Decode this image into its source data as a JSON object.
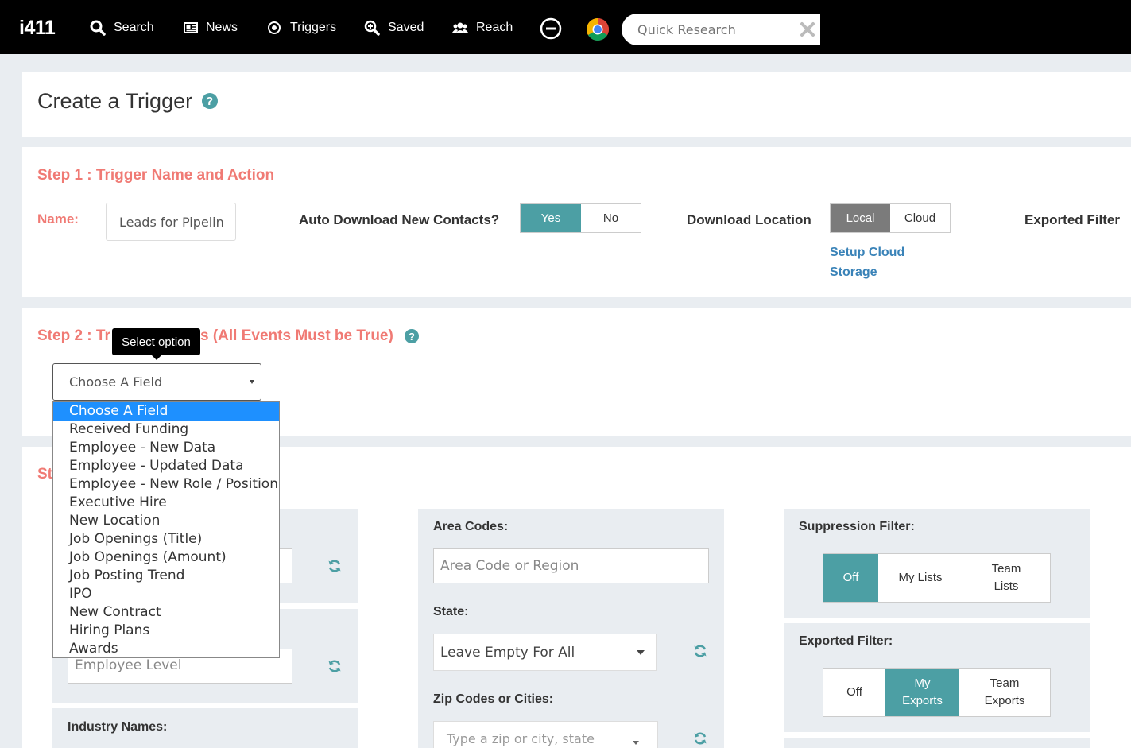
{
  "navbar": {
    "logo": "i411",
    "items": [
      {
        "label": "Search",
        "icon": "search-icon"
      },
      {
        "label": "News",
        "icon": "newspaper-icon"
      },
      {
        "label": "Triggers",
        "icon": "target-icon"
      },
      {
        "label": "Saved",
        "icon": "saved-search-icon"
      },
      {
        "label": "Reach",
        "icon": "users-icon"
      }
    ],
    "quick_research": {
      "placeholder": "Quick Research"
    }
  },
  "page": {
    "title": "Create a Trigger",
    "help": "?"
  },
  "step1": {
    "title": "Step 1 : Trigger Name and Action",
    "name_label": "Name:",
    "name_value": "Leads for Pipelin",
    "auto_download_label": "Auto Download New Contacts?",
    "auto_download_options": [
      "Yes",
      "No"
    ],
    "auto_download_selected": "Yes",
    "download_location_label": "Download Location",
    "download_location_options": [
      "Local",
      "Cloud"
    ],
    "download_location_selected": "Local",
    "setup_cloud_link": [
      "Setup Cloud",
      "Storage"
    ],
    "exported_filter_label": "Exported Filter"
  },
  "step2": {
    "title_start": "Step 2 : Tr",
    "title_end": "s (All Events Must be True)",
    "help": "?",
    "tooltip": "Select option",
    "field_select_value": "Choose A Field",
    "options": [
      "Choose A Field",
      "Received Funding",
      "Employee - New Data",
      "Employee - Updated Data",
      "Employee - New Role / Position",
      "Executive Hire",
      "New Location",
      "Job Openings (Title)",
      "Job Openings (Amount)",
      "Job Posting Trend",
      "IPO",
      "New Contract",
      "Hiring Plans",
      "Awards"
    ],
    "selected_option": "Choose A Field"
  },
  "step3": {
    "title_fragment": "St",
    "employee_level_placeholder": "Employee Level",
    "industry_names_label": "Industry Names:",
    "area_codes_label": "Area Codes:",
    "area_codes_placeholder": "Area Code or Region",
    "state_label": "State:",
    "state_value": "Leave Empty For All",
    "zip_label": "Zip Codes or Cities:",
    "zip_placeholder": "Type a zip or city, state",
    "suppression_label": "Suppression Filter:",
    "suppression_options": [
      "Off",
      "My Lists",
      "Team Lists"
    ],
    "suppression_selected": "Off",
    "exported_label": "Exported Filter:",
    "exported_options": [
      "Off",
      "My Exports",
      "Team Exports"
    ],
    "exported_selected": "My Exports"
  },
  "colors": {
    "teal": "#4c9fa4",
    "salmon": "#f07a74",
    "link": "#3a83b8",
    "highlight": "#1e90ff"
  }
}
